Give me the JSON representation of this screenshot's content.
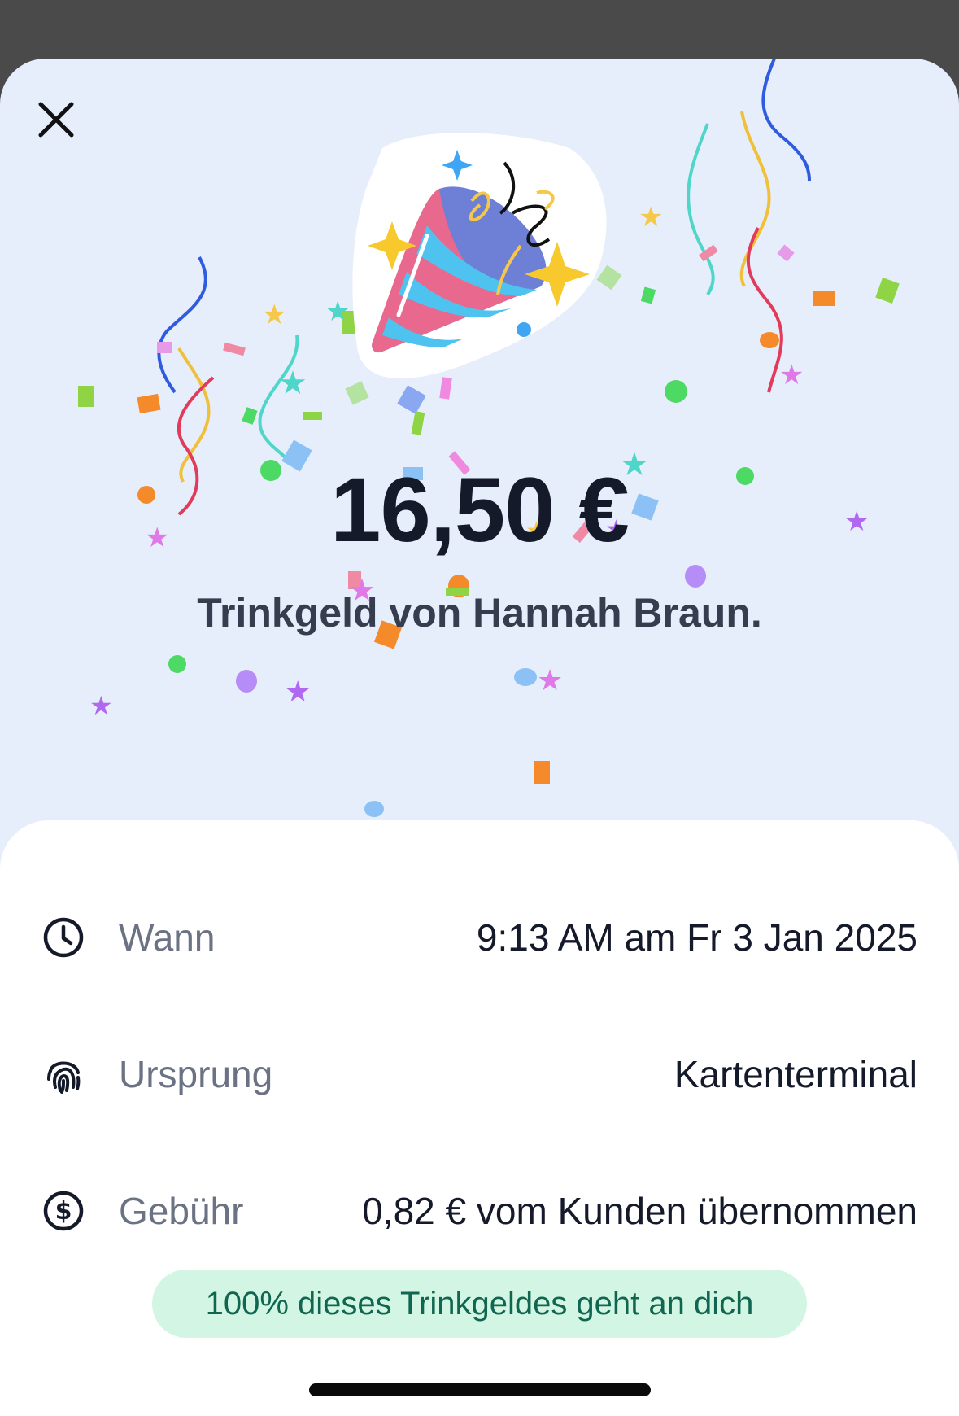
{
  "colors": {
    "sheet_background": "#e7eefb",
    "amount_text": "#151a2b",
    "label_text": "#6b7283",
    "banner_background": "#d3f6e4",
    "banner_text": "#106651"
  },
  "header": {
    "close_icon": "close-icon"
  },
  "hero": {
    "icon": "party-popper-icon",
    "amount": "16,50 €",
    "subtitle": "Trinkgeld von Hannah Braun."
  },
  "details": {
    "rows": [
      {
        "icon": "clock-icon",
        "label": "Wann",
        "value": "9:13 AM am Fr 3 Jan 2025"
      },
      {
        "icon": "fingerprint-icon",
        "label": "Ursprung",
        "value": "Kartenterminal"
      },
      {
        "icon": "dollar-circle-icon",
        "label": "Gebühr",
        "value": "0,82 € vom Kunden übernommen"
      }
    ]
  },
  "banner": {
    "text": "100% dieses Trinkgeldes geht an dich"
  }
}
